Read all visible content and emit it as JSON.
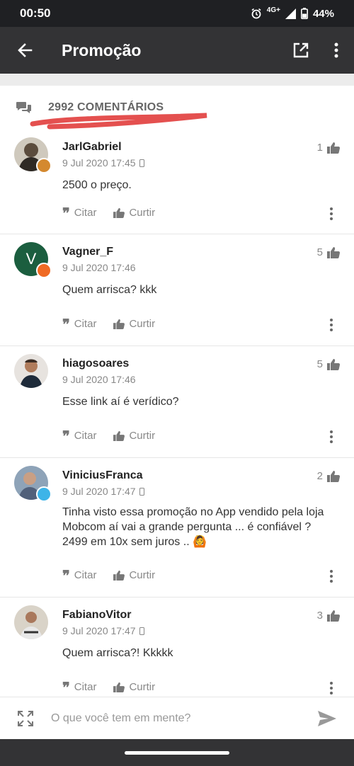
{
  "status_bar": {
    "time": "00:50",
    "network": "4G+",
    "battery": "44%"
  },
  "app_bar": {
    "title": "Promoção"
  },
  "comments_header": {
    "count_label": "2992 COMENTÁRIOS"
  },
  "comments": [
    {
      "username": "JarlGabriel",
      "date": "9 Jul 2020 17:45",
      "mobile": true,
      "likes": "1",
      "text": "2500 o preço.",
      "badge_color": "#d4892f"
    },
    {
      "username": "Vagner_F",
      "date": "9 Jul 2020 17:46",
      "mobile": false,
      "likes": "5",
      "text": "Quem arrisca? kkk",
      "avatar_letter": "V",
      "badge_color": "#ef6a24"
    },
    {
      "username": "hiagosoares",
      "date": "9 Jul 2020 17:46",
      "mobile": false,
      "likes": "5",
      "text": "Esse link aí é verídico?"
    },
    {
      "username": "ViniciusFranca",
      "date": "9 Jul 2020 17:47",
      "mobile": true,
      "likes": "2",
      "text": "Tinha visto essa promoção no App vendido pela loja Mobcom aí vai a grande pergunta ... é confiável ? 2499 em 10x sem juros .. 🙆",
      "badge_color": "#3db4e8"
    },
    {
      "username": "FabianoVitor",
      "date": "9 Jul 2020 17:47",
      "mobile": true,
      "likes": "3",
      "text": "Quem arrisca?! Kkkkk"
    }
  ],
  "actions": {
    "quote_label": "Citar",
    "like_label": "Curtir"
  },
  "input": {
    "placeholder": "O que você tem em mente?"
  },
  "colors": {
    "app_bar": "#333335",
    "status_bar": "#1f2023",
    "annotation_red": "#e4504f"
  }
}
